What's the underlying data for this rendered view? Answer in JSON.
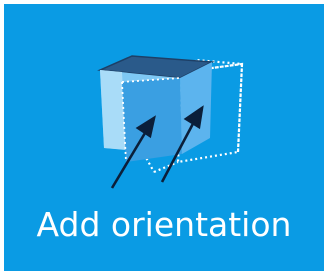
{
  "button": {
    "label": "Add orientation",
    "icon": "cube-rotate-icon",
    "background_color": "#0a9be4"
  }
}
